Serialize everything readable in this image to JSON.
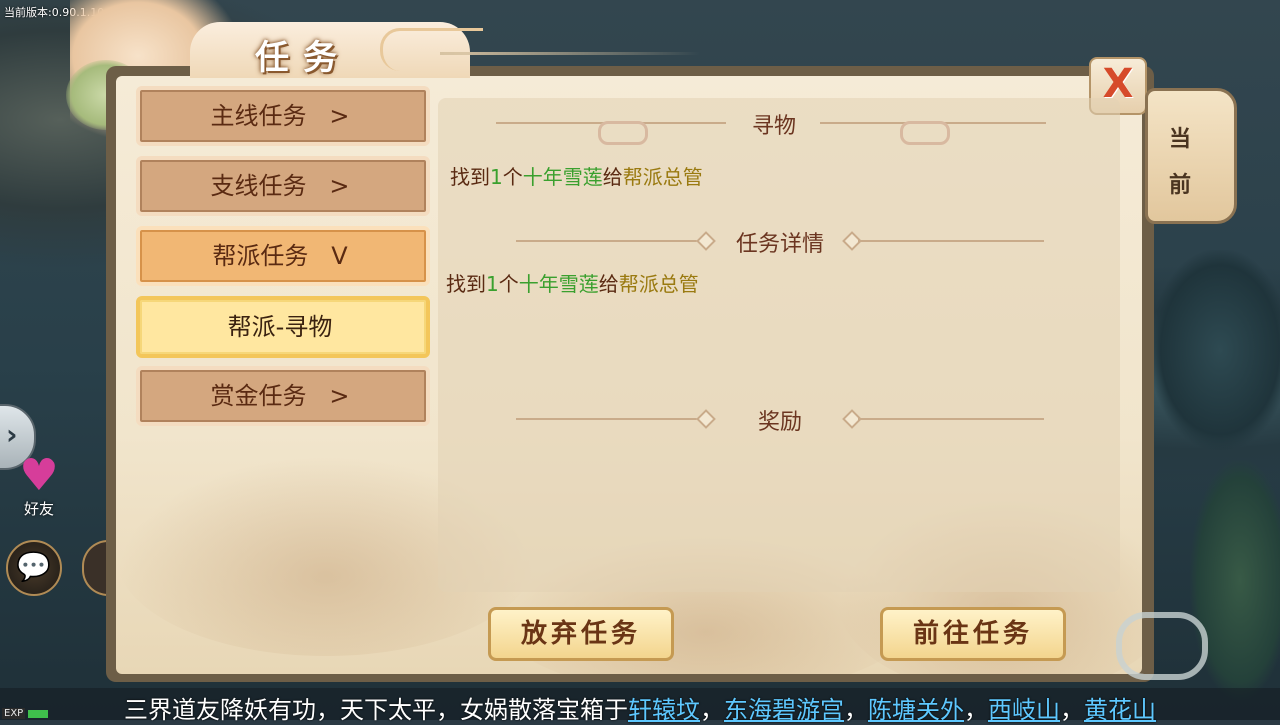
{
  "version_text": "当前版本:0.90.1.10",
  "hud": {
    "friend_label": "好友"
  },
  "panel": {
    "title": "任务",
    "close_symbol": "X",
    "side_tab": [
      "当",
      "前"
    ]
  },
  "nav": [
    {
      "label": "主线任务",
      "arrow": ">",
      "state": "collapsed"
    },
    {
      "label": "支线任务",
      "arrow": ">",
      "state": "collapsed"
    },
    {
      "label": "帮派任务",
      "arrow": "V",
      "state": "expanded"
    },
    {
      "label": "帮派-寻物",
      "arrow": "",
      "state": "selected"
    },
    {
      "label": "赏金任务",
      "arrow": ">",
      "state": "collapsed"
    }
  ],
  "content": {
    "objective_title": "寻物",
    "objective": {
      "p1": "找到",
      "num": "1",
      "p2": "个",
      "item": "十年雪莲",
      "p3": "给",
      "npc": "帮派总管"
    },
    "details_title": "任务详情",
    "details": {
      "p1": "找到",
      "num": "1",
      "p2": "个",
      "item": "十年雪莲",
      "p3": "给",
      "npc": "帮派总管"
    },
    "reward_title": "奖励"
  },
  "buttons": {
    "abandon": "放弃任务",
    "goto": "前往任务"
  },
  "ticker": {
    "prefix": "三界道友降妖有功，天下太平，女娲散落宝箱于",
    "locations": [
      "轩辕坟",
      "东海碧游宫",
      "陈塘关外",
      "西岐山",
      "黄花山"
    ],
    "sep": "，"
  },
  "exp_label": "EXP",
  "colors": {
    "quest_item": "#3aa02e",
    "quest_npc": "#9a7a10",
    "ticker_location": "#5ec8ff",
    "close_x": "#d64a2a"
  }
}
